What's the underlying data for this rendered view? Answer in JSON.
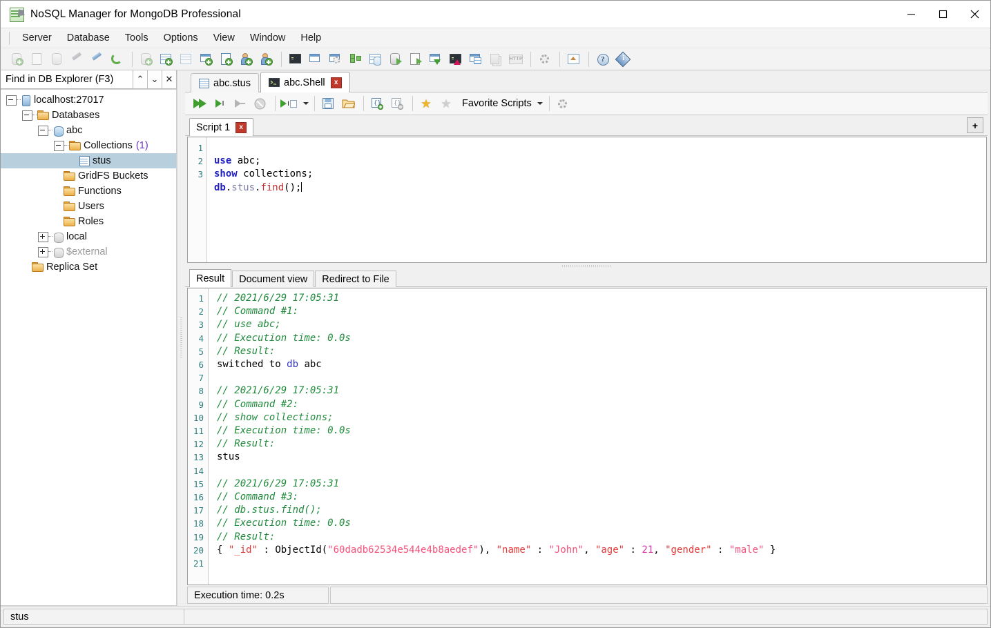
{
  "window": {
    "title": "NoSQL Manager for MongoDB Professional",
    "app_icon": "mongodb-sheet-icon",
    "controls": {
      "minimize": "minimize-icon",
      "maximize": "maximize-icon",
      "close": "close-icon"
    }
  },
  "menu": [
    {
      "label": "Server"
    },
    {
      "label": "Database"
    },
    {
      "label": "Tools"
    },
    {
      "label": "Options"
    },
    {
      "label": "View"
    },
    {
      "label": "Window"
    },
    {
      "label": "Help"
    }
  ],
  "toolbar": {
    "groups": [
      [
        "new-connection-icon",
        "edit-connection-icon",
        "copy-connection-icon",
        "connect-icon",
        "disconnect-icon",
        "refresh-icon"
      ],
      [
        "new-database-icon",
        "new-collection-icon",
        "new-view-icon",
        "new-window-icon",
        "new-function-icon",
        "new-user-icon",
        "new-role-icon"
      ],
      [
        "shell-icon",
        "document-view-icon",
        "aggregation-icon",
        "tree-view-icon",
        "collection-stats-icon",
        "import-icon",
        "export-icon",
        "import-data-icon",
        "export-data-icon",
        "shell-window-icon",
        "backup-icon",
        "http-icon"
      ],
      [
        "options-icon"
      ],
      [
        "home-icon"
      ],
      [
        "help-icon",
        "about-icon"
      ]
    ]
  },
  "sidebar": {
    "find": {
      "label": "Find in DB Explorer (F3)",
      "up": "⌃",
      "down": "⌄",
      "close": "✕"
    },
    "tree": [
      {
        "label": "localhost:27017",
        "icon": "server-icon",
        "depth": 0,
        "expander": "minus"
      },
      {
        "label": "Databases",
        "icon": "folder-icon",
        "depth": 1,
        "expander": "minus"
      },
      {
        "label": "abc",
        "icon": "database-icon",
        "depth": 2,
        "expander": "minus"
      },
      {
        "label": "Collections",
        "suffix": "(1)",
        "icon": "folder-icon",
        "depth": 3,
        "expander": "minus"
      },
      {
        "label": "stus",
        "icon": "collection-icon",
        "depth": 4,
        "expander": "none",
        "selected": true
      },
      {
        "label": "GridFS Buckets",
        "icon": "folder-icon",
        "depth": 3,
        "expander": "none"
      },
      {
        "label": "Functions",
        "icon": "folder-icon",
        "depth": 3,
        "expander": "none"
      },
      {
        "label": "Users",
        "icon": "folder-icon",
        "depth": 3,
        "expander": "none"
      },
      {
        "label": "Roles",
        "icon": "folder-icon",
        "depth": 3,
        "expander": "none"
      },
      {
        "label": "local",
        "icon": "database-icon-gray",
        "depth": 2,
        "expander": "plus"
      },
      {
        "label": "$external",
        "icon": "database-icon-gray",
        "depth": 2,
        "expander": "plus",
        "dim": true
      },
      {
        "label": "Replica Set",
        "icon": "folder-icon",
        "depth": 1,
        "expander": "none"
      }
    ],
    "status": ""
  },
  "tabs": [
    {
      "label": "abc.stus",
      "icon": "collection-icon",
      "active": false,
      "closable": false
    },
    {
      "label": "abc.Shell",
      "icon": "shell-icon",
      "active": true,
      "closable": true,
      "close_label": "x"
    }
  ],
  "shell_toolbar": {
    "buttons": [
      "execute-all-icon",
      "execute-current-icon",
      "execute-step-icon",
      "stop-icon",
      "execute-options-icon",
      "save-script-icon",
      "open-script-icon",
      "format-json-icon",
      "unformat-json-icon",
      "add-favorite-icon",
      "remove-favorite-icon"
    ],
    "favorite_scripts_label": "Favorite Scripts",
    "settings_icon": "gear-icon"
  },
  "script_tabs": {
    "tabs": [
      {
        "label": "Script 1",
        "close_label": "x",
        "active": true
      }
    ],
    "add_label": "+"
  },
  "editor": {
    "line_numbers": [
      "1",
      "2",
      "3"
    ],
    "lines": [
      [
        {
          "t": "use",
          "c": "kw"
        },
        {
          "t": " abc;",
          "c": "id"
        }
      ],
      [
        {
          "t": "show",
          "c": "kw"
        },
        {
          "t": " collections;",
          "c": "id"
        }
      ],
      [
        {
          "t": "db",
          "c": "kw"
        },
        {
          "t": ".",
          "c": "id"
        },
        {
          "t": "stus",
          "c": "obj"
        },
        {
          "t": ".",
          "c": "id"
        },
        {
          "t": "find",
          "c": "fn"
        },
        {
          "t": "();",
          "c": "id"
        }
      ]
    ]
  },
  "result_tabs": [
    {
      "label": "Result",
      "active": true
    },
    {
      "label": "Document view",
      "active": false
    },
    {
      "label": "Redirect to File",
      "active": false
    }
  ],
  "result": {
    "line_numbers": [
      "1",
      "2",
      "3",
      "4",
      "5",
      "6",
      "7",
      "8",
      "9",
      "10",
      "11",
      "12",
      "13",
      "14",
      "15",
      "16",
      "17",
      "18",
      "19",
      "20",
      "21"
    ],
    "lines": [
      [
        {
          "t": "// 2021/6/29 17:05:31",
          "c": "cmt"
        }
      ],
      [
        {
          "t": "// Command #1:",
          "c": "cmt"
        }
      ],
      [
        {
          "t": "// use abc;",
          "c": "cmt"
        }
      ],
      [
        {
          "t": "// Execution time: 0.0s",
          "c": "cmt"
        }
      ],
      [
        {
          "t": "// Result:",
          "c": "cmt"
        }
      ],
      [
        {
          "t": "switched to ",
          "c": "jplain"
        },
        {
          "t": "db",
          "c": "dbkw"
        },
        {
          "t": " abc",
          "c": "jplain"
        }
      ],
      [
        {
          "t": "",
          "c": "jplain"
        }
      ],
      [
        {
          "t": "// 2021/6/29 17:05:31",
          "c": "cmt"
        }
      ],
      [
        {
          "t": "// Command #2:",
          "c": "cmt"
        }
      ],
      [
        {
          "t": "// show collections;",
          "c": "cmt"
        }
      ],
      [
        {
          "t": "// Execution time: 0.0s",
          "c": "cmt"
        }
      ],
      [
        {
          "t": "// Result:",
          "c": "cmt"
        }
      ],
      [
        {
          "t": "stus",
          "c": "jplain"
        }
      ],
      [
        {
          "t": "",
          "c": "jplain"
        }
      ],
      [
        {
          "t": "// 2021/6/29 17:05:31",
          "c": "cmt"
        }
      ],
      [
        {
          "t": "// Command #3:",
          "c": "cmt"
        }
      ],
      [
        {
          "t": "// db.stus.find();",
          "c": "cmt"
        }
      ],
      [
        {
          "t": "// Execution time: 0.0s",
          "c": "cmt"
        }
      ],
      [
        {
          "t": "// Result:",
          "c": "cmt"
        }
      ],
      [
        {
          "t": "{ ",
          "c": "jplain"
        },
        {
          "t": "\"_id\"",
          "c": "jkey"
        },
        {
          "t": " : ",
          "c": "jplain"
        },
        {
          "t": "ObjectId(",
          "c": "jplain"
        },
        {
          "t": "\"60dadb62534e544e4b8aedef\"",
          "c": "jstr"
        },
        {
          "t": "), ",
          "c": "jplain"
        },
        {
          "t": "\"name\"",
          "c": "jkey"
        },
        {
          "t": " : ",
          "c": "jplain"
        },
        {
          "t": "\"John\"",
          "c": "jstr"
        },
        {
          "t": ", ",
          "c": "jplain"
        },
        {
          "t": "\"age\"",
          "c": "jkey"
        },
        {
          "t": " : ",
          "c": "jplain"
        },
        {
          "t": "21",
          "c": "jnum"
        },
        {
          "t": ", ",
          "c": "jplain"
        },
        {
          "t": "\"gender\"",
          "c": "jkey"
        },
        {
          "t": " : ",
          "c": "jplain"
        },
        {
          "t": "\"male\"",
          "c": "jstr"
        },
        {
          "t": " }",
          "c": "jplain"
        }
      ],
      [
        {
          "t": "",
          "c": "jplain"
        }
      ]
    ]
  },
  "main_status": {
    "execution_time": "Execution time: 0.2s",
    "right": ""
  },
  "bottom_status": {
    "left": "stus",
    "right": ""
  }
}
